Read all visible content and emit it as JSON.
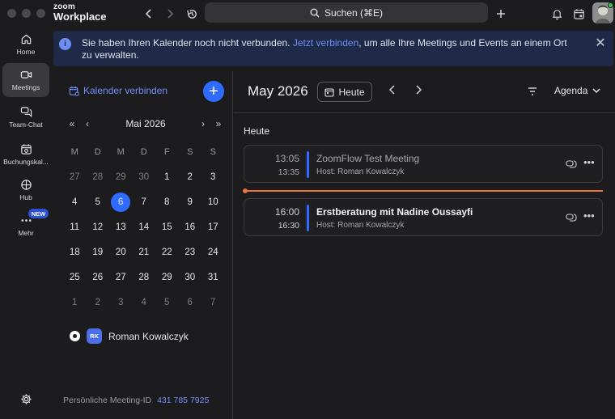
{
  "titlebar": {
    "logo_line1": "zoom",
    "logo_line2": "Workplace",
    "search_label": "Suchen (⌘E)"
  },
  "nav": {
    "items": [
      {
        "label": "Home",
        "icon": "home-icon"
      },
      {
        "label": "Meetings",
        "icon": "video-camera-icon"
      },
      {
        "label": "Team-Chat",
        "icon": "chat-bubbles-icon"
      },
      {
        "label": "Buchungskal...",
        "icon": "booking-calendar-icon"
      },
      {
        "label": "Hub",
        "icon": "hub-icon"
      },
      {
        "label": "Mehr",
        "icon": "more-dots-icon"
      }
    ],
    "new_badge": "NEW"
  },
  "banner": {
    "text_before": "Sie haben Ihren Kalender noch nicht verbunden. ",
    "link": "Jetzt verbinden",
    "text_after": ", um alle Ihre Meetings und Events an einem Ort zu verwalten."
  },
  "left_panel": {
    "connect_label": "Kalender verbinden",
    "month_label": "Mai 2026",
    "weekdays": [
      "M",
      "D",
      "M",
      "D",
      "F",
      "S",
      "S"
    ],
    "weeks": [
      [
        {
          "d": "27",
          "dim": true
        },
        {
          "d": "28",
          "dim": true
        },
        {
          "d": "29",
          "dim": true
        },
        {
          "d": "30",
          "dim": true
        },
        {
          "d": "1"
        },
        {
          "d": "2"
        },
        {
          "d": "3"
        }
      ],
      [
        {
          "d": "4"
        },
        {
          "d": "5"
        },
        {
          "d": "6",
          "today": true
        },
        {
          "d": "7"
        },
        {
          "d": "8"
        },
        {
          "d": "9"
        },
        {
          "d": "10"
        }
      ],
      [
        {
          "d": "11"
        },
        {
          "d": "12"
        },
        {
          "d": "13"
        },
        {
          "d": "14"
        },
        {
          "d": "15"
        },
        {
          "d": "16"
        },
        {
          "d": "17"
        }
      ],
      [
        {
          "d": "18"
        },
        {
          "d": "19"
        },
        {
          "d": "20"
        },
        {
          "d": "21"
        },
        {
          "d": "22"
        },
        {
          "d": "23"
        },
        {
          "d": "24"
        }
      ],
      [
        {
          "d": "25"
        },
        {
          "d": "26"
        },
        {
          "d": "27"
        },
        {
          "d": "28"
        },
        {
          "d": "29"
        },
        {
          "d": "30"
        },
        {
          "d": "31"
        }
      ],
      [
        {
          "d": "1",
          "dim": true
        },
        {
          "d": "2",
          "dim": true
        },
        {
          "d": "3",
          "dim": true
        },
        {
          "d": "4",
          "dim": true
        },
        {
          "d": "5",
          "dim": true
        },
        {
          "d": "6",
          "dim": true
        },
        {
          "d": "7",
          "dim": true
        }
      ]
    ],
    "owner_initials": "RK",
    "owner_name": "Roman Kowalczyk",
    "meeting_id_label": "Persönliche Meeting-ID",
    "meeting_id": "431 785 7925"
  },
  "main": {
    "title": "May 2026",
    "today_button": "Heute",
    "view_label": "Agenda",
    "section_label": "Heute",
    "events": [
      {
        "start": "13:05",
        "end": "13:35",
        "title": "ZoomFlow Test Meeting",
        "host": "Host: Roman Kowalczyk",
        "past": true
      },
      {
        "start": "16:00",
        "end": "16:30",
        "title": "Erstberatung mit Nadine Oussayfi",
        "host": "Host: Roman Kowalczyk",
        "past": false
      }
    ]
  },
  "colors": {
    "accent": "#2f6bff",
    "link": "#6f8ff7",
    "now_line": "#e9723f",
    "banner_bg": "#1e2a47"
  }
}
